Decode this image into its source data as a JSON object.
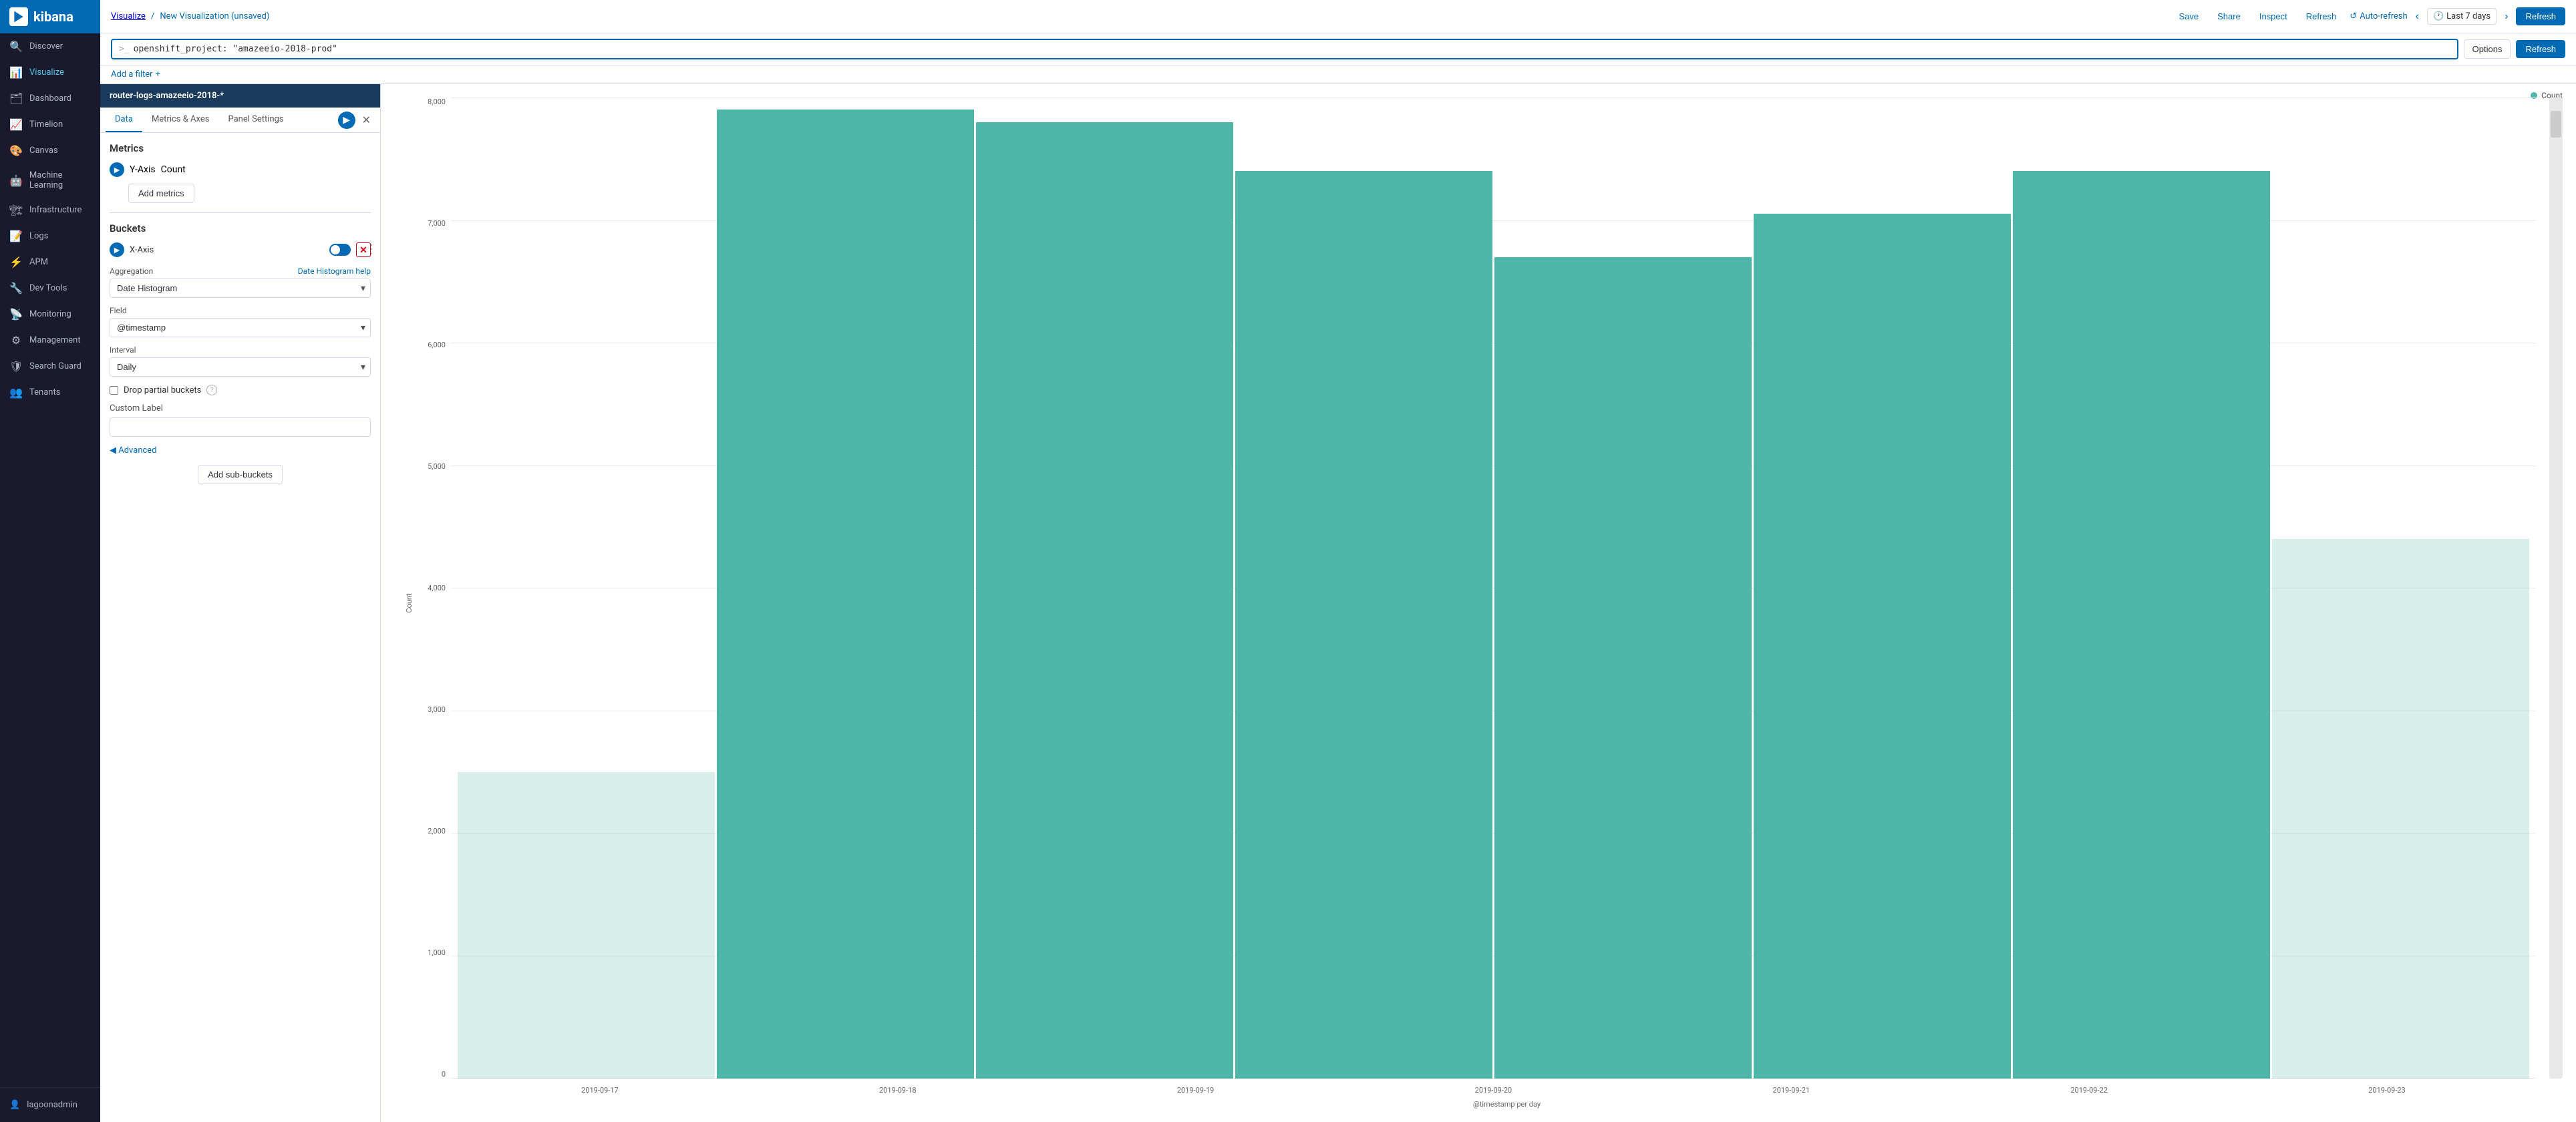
{
  "sidebar": {
    "logo": "kibana",
    "items": [
      {
        "id": "discover",
        "label": "Discover",
        "icon": "🔍"
      },
      {
        "id": "visualize",
        "label": "Visualize",
        "icon": "📊",
        "active": true
      },
      {
        "id": "dashboard",
        "label": "Dashboard",
        "icon": "🗂"
      },
      {
        "id": "timelion",
        "label": "Timelion",
        "icon": "📈"
      },
      {
        "id": "canvas",
        "label": "Canvas",
        "icon": "🎨"
      },
      {
        "id": "machine-learning",
        "label": "Machine Learning",
        "icon": "🤖"
      },
      {
        "id": "infrastructure",
        "label": "Infrastructure",
        "icon": "🏗"
      },
      {
        "id": "logs",
        "label": "Logs",
        "icon": "📝"
      },
      {
        "id": "apm",
        "label": "APM",
        "icon": "⚡"
      },
      {
        "id": "dev-tools",
        "label": "Dev Tools",
        "icon": "🔧"
      },
      {
        "id": "monitoring",
        "label": "Monitoring",
        "icon": "📡"
      },
      {
        "id": "management",
        "label": "Management",
        "icon": "⚙"
      },
      {
        "id": "search-guard",
        "label": "Search Guard",
        "icon": "🛡"
      },
      {
        "id": "tenants",
        "label": "Tenants",
        "icon": "👥"
      }
    ],
    "user": "lagoonadmin"
  },
  "topbar": {
    "breadcrumb_link": "Visualize",
    "breadcrumb_sep": "/",
    "title": "New Visualization (unsaved)",
    "save_label": "Save",
    "share_label": "Share",
    "inspect_label": "Inspect",
    "refresh_label": "Refresh",
    "autorefresh_label": "Auto-refresh",
    "timerange_label": "Last 7 days",
    "refresh_btn": "Refresh"
  },
  "querybar": {
    "prompt": ">_",
    "query": "openshift_project: \"amazeeio-2018-prod\"",
    "options_label": "Options",
    "refresh_label": "Refresh"
  },
  "filterbar": {
    "add_filter": "Add a filter",
    "add_icon": "+"
  },
  "left_panel": {
    "index_pattern": "router-logs-amazeeio-2018-*",
    "tabs": [
      {
        "id": "data",
        "label": "Data",
        "active": true
      },
      {
        "id": "metrics-axes",
        "label": "Metrics & Axes"
      },
      {
        "id": "panel-settings",
        "label": "Panel Settings"
      }
    ],
    "metrics": {
      "title": "Metrics",
      "items": [
        {
          "id": "y-axis",
          "label": "Y-Axis",
          "metric": "Count"
        }
      ],
      "add_metrics_label": "Add metrics"
    },
    "buckets": {
      "title": "Buckets",
      "items": [
        {
          "id": "x-axis",
          "label": "X-Axis",
          "enabled": true
        }
      ],
      "aggregation_label": "Aggregation",
      "aggregation_help_link": "Date Histogram help",
      "aggregation_value": "Date Histogram",
      "field_label": "Field",
      "field_value": "@timestamp",
      "interval_label": "Interval",
      "interval_value": "Daily",
      "drop_partial_label": "Drop partial buckets",
      "custom_label_title": "Custom Label",
      "custom_label_placeholder": "",
      "advanced_label": "Advanced",
      "add_sub_buckets_label": "Add sub-buckets"
    }
  },
  "chart": {
    "legend_label": "Count",
    "y_axis_title": "Count",
    "x_axis_title": "@timestamp per day",
    "y_labels": [
      "8,000",
      "7,000",
      "6,000",
      "5,000",
      "4,000",
      "3,000",
      "2,000",
      "1,000",
      "0"
    ],
    "bars": [
      {
        "date": "2019-09-17",
        "value": 2500,
        "height_pct": 31,
        "partial": true
      },
      {
        "date": "2019-09-17",
        "value": 7900,
        "height_pct": 99
      },
      {
        "date": "2019-09-18",
        "value": 7800,
        "height_pct": 97
      },
      {
        "date": "2019-09-19",
        "value": 7400,
        "height_pct": 92
      },
      {
        "date": "2019-09-20",
        "value": 6700,
        "height_pct": 84
      },
      {
        "date": "2019-09-21",
        "value": 7050,
        "height_pct": 88
      },
      {
        "date": "2019-09-22",
        "value": 7400,
        "height_pct": 93
      },
      {
        "date": "2019-09-23",
        "value": 4400,
        "height_pct": 55,
        "partial": true
      }
    ],
    "x_labels": [
      "2019-09-17",
      "2019-09-18",
      "2019-09-19",
      "2019-09-20",
      "2019-09-21",
      "2019-09-22",
      "2019-09-23"
    ]
  },
  "colors": {
    "bar": "#4db6a8",
    "bar_hover": "#3da898",
    "accent": "#006bb4",
    "sidebar_bg": "#1a1a2e",
    "sidebar_header": "#006bb4"
  }
}
